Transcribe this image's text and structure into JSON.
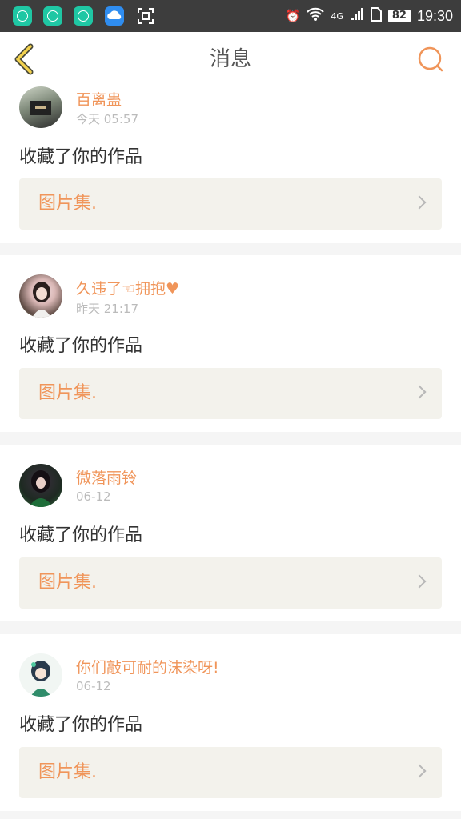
{
  "status_bar": {
    "time": "19:30",
    "battery": "82",
    "network": "4G",
    "app_icons": [
      "upload-icon",
      "upload-icon",
      "upload-icon",
      "cloud-icon",
      "scan-icon"
    ]
  },
  "header": {
    "title": "消息",
    "accent_color": "#f0955a"
  },
  "notifications": [
    {
      "username": "百离蛊",
      "time": "今天 05:57",
      "action": "收藏了你的作品",
      "work_title": "图片集."
    },
    {
      "username": "久违了☜拥抱♥",
      "time": "昨天 21:17",
      "action": "收藏了你的作品",
      "work_title": "图片集."
    },
    {
      "username": "微落雨铃",
      "time": "06-12",
      "action": "收藏了你的作品",
      "work_title": "图片集."
    },
    {
      "username": "你们敲可耐的沫染呀!",
      "time": "06-12",
      "action": "收藏了你的作品",
      "work_title": "图片集."
    }
  ]
}
